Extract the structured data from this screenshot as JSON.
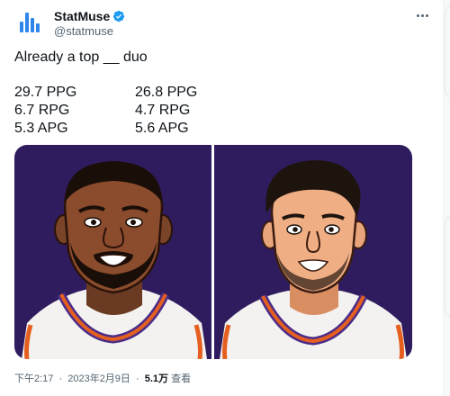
{
  "account": {
    "name": "StatMuse",
    "handle": "@statmuse",
    "verified": true,
    "brand_color": "#2f86ea"
  },
  "tweet": {
    "text": "Already a top __ duo",
    "stats": {
      "left": [
        "29.7 PPG",
        "6.7 RPG",
        "5.3 APG"
      ],
      "right": [
        "26.8 PPG",
        "4.7 RPG",
        "5.6 APG"
      ]
    },
    "media": {
      "background": "#2f1c5e",
      "jersey": "#f4f2f0",
      "trim_orange": "#e56020",
      "trim_purple": "#4b2c88"
    },
    "meta": {
      "time": "下午2:17",
      "sep": "·",
      "date": "2023年2月9日",
      "views_count": "5.1万",
      "views_label": " 查看"
    }
  },
  "icons": {
    "more": "more-horizontal-icon",
    "verified": "verified-badge-icon"
  }
}
